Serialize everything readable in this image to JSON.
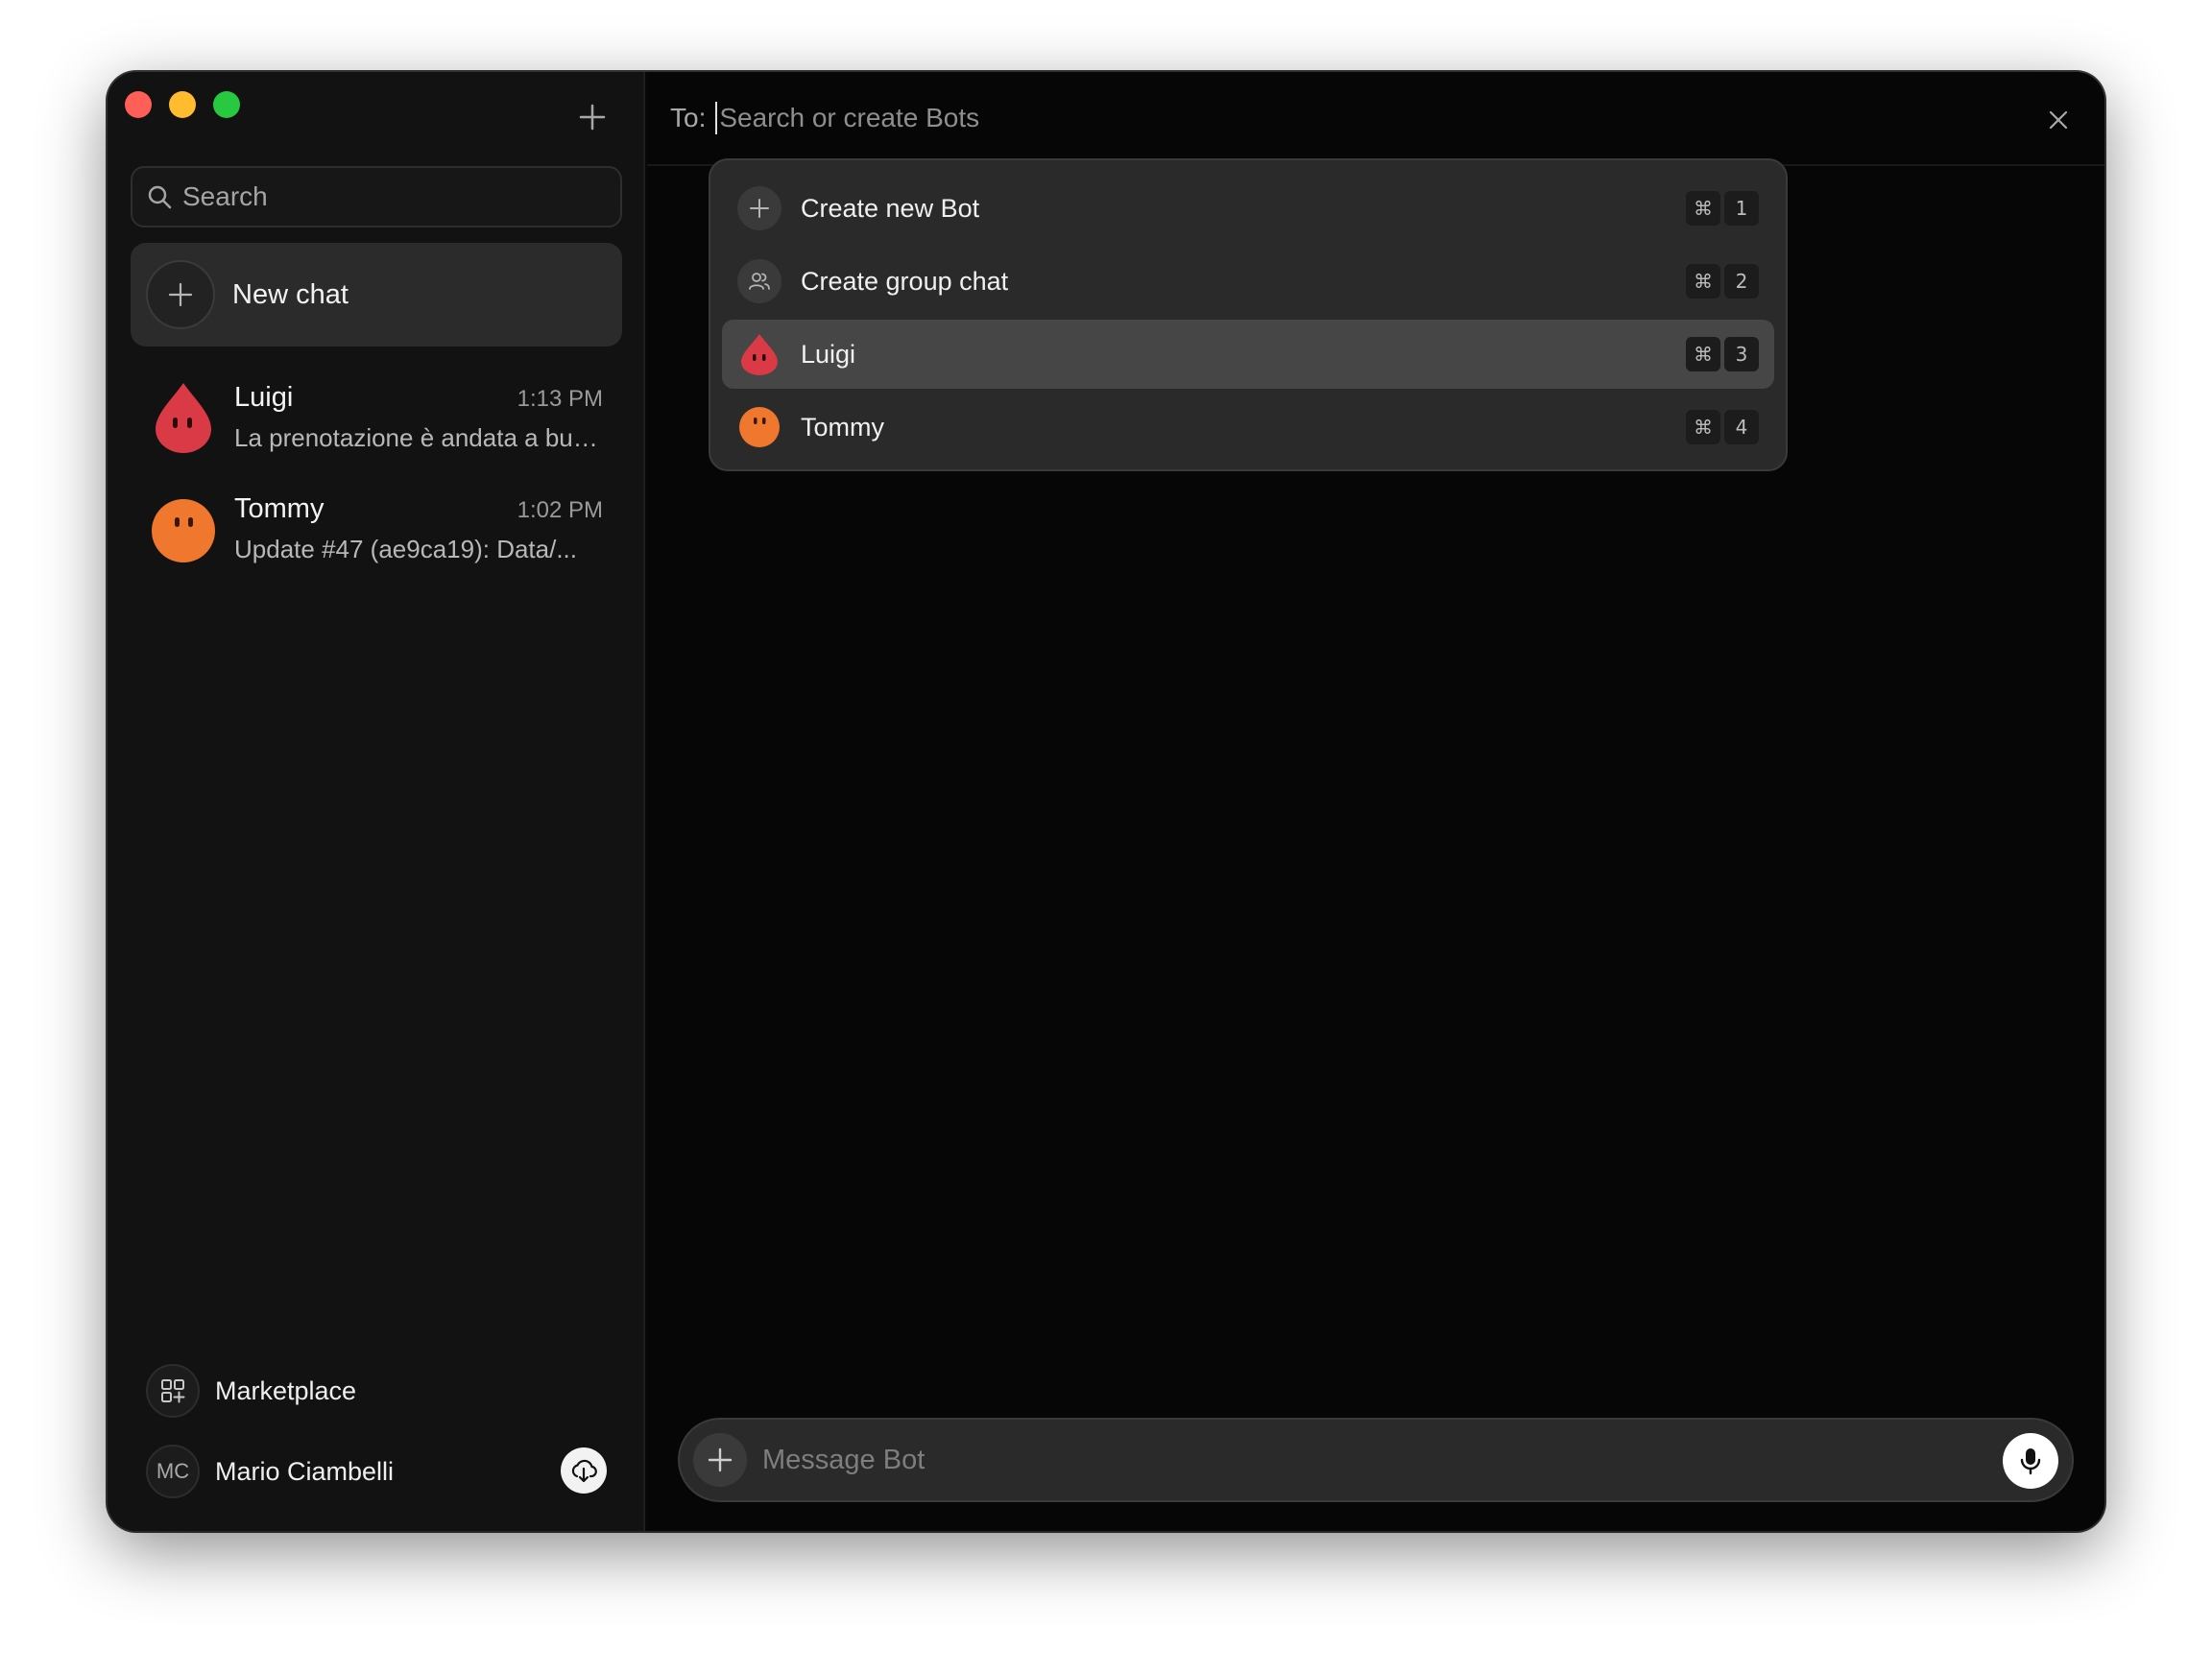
{
  "sidebar": {
    "search_placeholder": "Search",
    "new_chat_label": "New chat",
    "chats": [
      {
        "name": "Luigi",
        "time": "1:13 PM",
        "preview": "La prenotazione è andata a buon fine",
        "avatar": "red-drop-avatar",
        "color": "#d93a45"
      },
      {
        "name": "Tommy",
        "time": "1:02 PM",
        "preview": "Update #47 (ae9ca19): Data/...",
        "avatar": "orange-circle-avatar",
        "color": "#f0782e"
      }
    ],
    "marketplace_label": "Marketplace",
    "user": {
      "initials": "MC",
      "name": "Mario Ciambelli"
    }
  },
  "main": {
    "to_label": "To:",
    "to_placeholder": "Search or create Bots",
    "dropdown": [
      {
        "label": "Create new Bot",
        "icon": "plus-icon",
        "key": "1"
      },
      {
        "label": "Create group chat",
        "icon": "group-icon",
        "key": "2"
      },
      {
        "label": "Luigi",
        "icon": "red-drop-avatar",
        "key": "3",
        "selected": true
      },
      {
        "label": "Tommy",
        "icon": "orange-circle-avatar",
        "key": "4"
      }
    ],
    "shortcut_modifier": "⌘",
    "composer_placeholder": "Message Bot"
  }
}
